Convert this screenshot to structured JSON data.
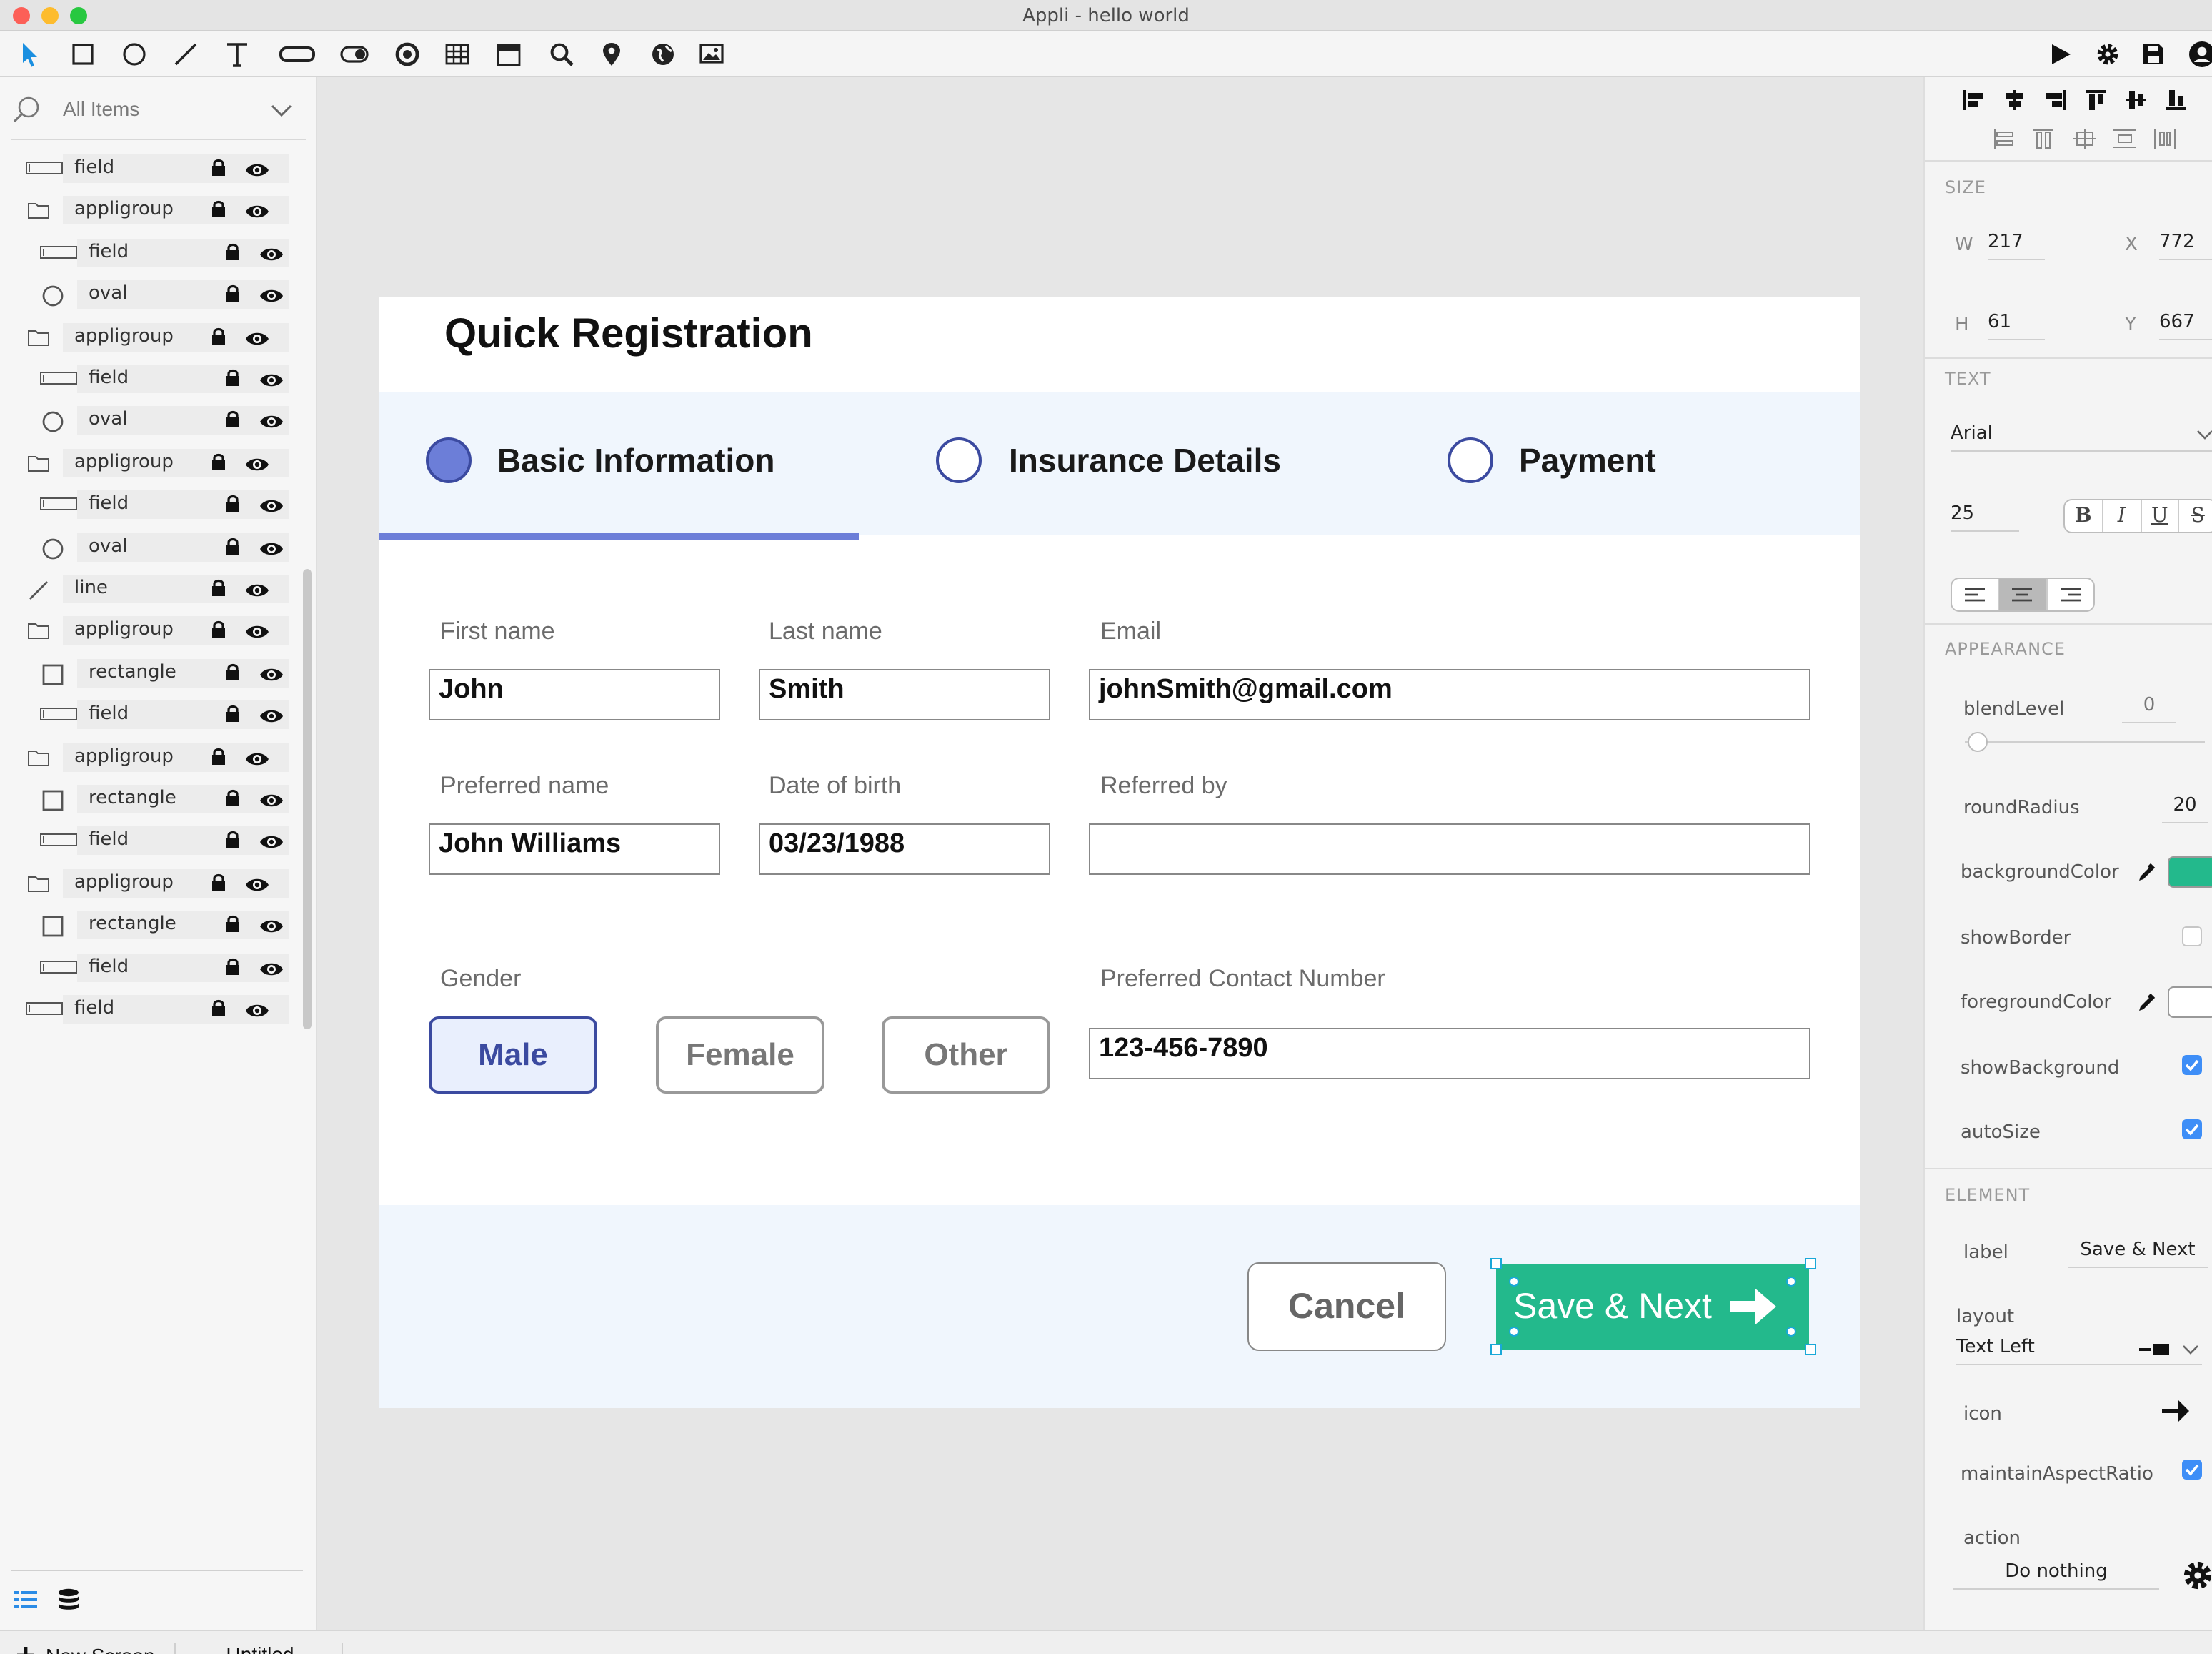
{
  "window": {
    "title": "Appli - hello world"
  },
  "toolbar": {
    "left_tools": [
      "pointer-icon",
      "rectangle-icon",
      "oval-icon",
      "line-icon",
      "text-icon",
      "field-icon",
      "toggle-icon",
      "radio-icon",
      "table-icon",
      "calendar-icon",
      "search-icon",
      "location-icon",
      "globe-icon",
      "image-icon"
    ],
    "right_tools": [
      "play-icon",
      "gear-icon",
      "save-icon",
      "user-icon"
    ]
  },
  "layers": {
    "search_label": "All Items",
    "items": [
      {
        "name": "field",
        "type": "field",
        "indent": 0
      },
      {
        "name": "appligroup",
        "type": "group",
        "indent": 0
      },
      {
        "name": "field",
        "type": "field",
        "indent": 1
      },
      {
        "name": "oval",
        "type": "oval",
        "indent": 1
      },
      {
        "name": "appligroup",
        "type": "group",
        "indent": 0
      },
      {
        "name": "field",
        "type": "field",
        "indent": 1
      },
      {
        "name": "oval",
        "type": "oval",
        "indent": 1
      },
      {
        "name": "appligroup",
        "type": "group",
        "indent": 0
      },
      {
        "name": "field",
        "type": "field",
        "indent": 1
      },
      {
        "name": "oval",
        "type": "oval",
        "indent": 1
      },
      {
        "name": "line",
        "type": "line",
        "indent": 0
      },
      {
        "name": "appligroup",
        "type": "group",
        "indent": 0
      },
      {
        "name": "rectangle",
        "type": "rect",
        "indent": 1
      },
      {
        "name": "field",
        "type": "field",
        "indent": 1
      },
      {
        "name": "appligroup",
        "type": "group",
        "indent": 0
      },
      {
        "name": "rectangle",
        "type": "rect",
        "indent": 1
      },
      {
        "name": "field",
        "type": "field",
        "indent": 1
      },
      {
        "name": "appligroup",
        "type": "group",
        "indent": 0
      },
      {
        "name": "rectangle",
        "type": "rect",
        "indent": 1
      },
      {
        "name": "field",
        "type": "field",
        "indent": 1
      },
      {
        "name": "field",
        "type": "field",
        "indent": 0
      }
    ]
  },
  "form": {
    "title": "Quick Registration",
    "steps": [
      "Basic Information",
      "Insurance Details",
      "Payment"
    ],
    "labels": {
      "first_name": "First name",
      "last_name": "Last name",
      "email": "Email",
      "preferred_name": "Preferred name",
      "dob": "Date of birth",
      "referred_by": "Referred by",
      "gender": "Gender",
      "contact": "Preferred Contact Number"
    },
    "values": {
      "first_name": "John",
      "last_name": "Smith",
      "email": "johnSmith@gmail.com",
      "preferred_name": "John Williams",
      "dob": "03/23/1988",
      "referred_by": "",
      "contact": "123-456-7890"
    },
    "gender_options": [
      "Male",
      "Female",
      "Other"
    ],
    "cancel": "Cancel",
    "save_next": "Save & Next"
  },
  "inspector": {
    "size_header": "SIZE",
    "w_label": "W",
    "w": "217",
    "x_label": "X",
    "x": "772",
    "h_label": "H",
    "h": "61",
    "y_label": "Y",
    "y": "667",
    "text_header": "TEXT",
    "font": "Arial",
    "font_size": "25",
    "style_buttons": [
      "B",
      "I",
      "U",
      "S"
    ],
    "appearance_header": "APPEARANCE",
    "blend_label": "blendLevel",
    "blend": "0",
    "round_label": "roundRadius",
    "round": "20",
    "bg_label": "backgroundColor",
    "bg_color": "#23b98c",
    "show_border_label": "showBorder",
    "fg_label": "foregroundColor",
    "fg_color": "#ffffff",
    "show_bg_label": "showBackground",
    "autosize_label": "autoSize",
    "element_header": "ELEMENT",
    "label_label": "label",
    "label": "Save & Next",
    "layout_label": "layout",
    "layout": "Text Left",
    "icon_label": "icon",
    "aspect_label": "maintainAspectRatio",
    "action_label": "action",
    "action": "Do nothing"
  },
  "bottom": {
    "new_screen": "New Screen",
    "tab": "Untitled"
  },
  "colors": {
    "accent": "#6c7ed8",
    "button_green": "#23b98c",
    "check_blue": "#3e8ef7"
  }
}
